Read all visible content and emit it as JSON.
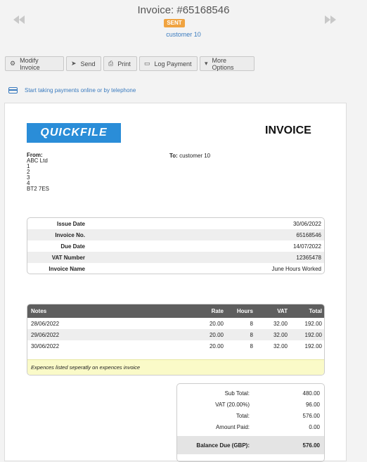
{
  "header": {
    "title": "Invoice: #65168546",
    "status": "SENT",
    "customer": "customer 10"
  },
  "toolbar": {
    "modify": "Modify Invoice",
    "send": "Send",
    "print": "Print",
    "log_payment": "Log Payment",
    "more": "More Options"
  },
  "online_payments_link": "Start taking payments online or by telephone",
  "invoice": {
    "logo": "QUICKFILE",
    "doc_title": "INVOICE",
    "from_label": "From:",
    "from_lines": [
      "ABC Ltd",
      "1",
      "2",
      "3",
      "4",
      "BT2 7ES"
    ],
    "to_label": "To:",
    "to_value": "customer 10",
    "info": [
      {
        "label": "Issue Date",
        "value": "30/06/2022"
      },
      {
        "label": "Invoice No.",
        "value": "65168546"
      },
      {
        "label": "Due Date",
        "value": "14/07/2022"
      },
      {
        "label": "VAT Number",
        "value": "12365478"
      },
      {
        "label": "Invoice Name",
        "value": "June Hours Worked"
      }
    ],
    "columns": {
      "notes": "Notes",
      "rate": "Rate",
      "hours": "Hours",
      "vat": "VAT",
      "total": "Total"
    },
    "lines": [
      {
        "notes": "28/06/2022",
        "rate": "20.00",
        "hours": "8",
        "vat": "32.00",
        "total": "192.00"
      },
      {
        "notes": "29/06/2022",
        "rate": "20.00",
        "hours": "8",
        "vat": "32.00",
        "total": "192.00"
      },
      {
        "notes": "30/06/2022",
        "rate": "20.00",
        "hours": "8",
        "vat": "32.00",
        "total": "192.00"
      }
    ],
    "footnote": "Expences listed seperatly on expences invoice",
    "totals": [
      {
        "label": "Sub Total:",
        "value": "480.00"
      },
      {
        "label": "VAT (20.00%)",
        "value": "96.00"
      },
      {
        "label": "Total:",
        "value": "576.00"
      },
      {
        "label": "Amount Paid:",
        "value": "0.00"
      }
    ],
    "balance": {
      "label": "Balance Due (GBP):",
      "value": "576.00"
    }
  },
  "colors": {
    "accent": "#3a7bbf",
    "badge": "#f0a340",
    "logo_bg": "#2a8dd8",
    "table_head": "#5e5e5e",
    "note_bg": "#fafac8"
  },
  "icons": {
    "prev": "double-chevron-left-icon",
    "next": "double-chevron-right-icon",
    "card": "credit-card-icon"
  }
}
